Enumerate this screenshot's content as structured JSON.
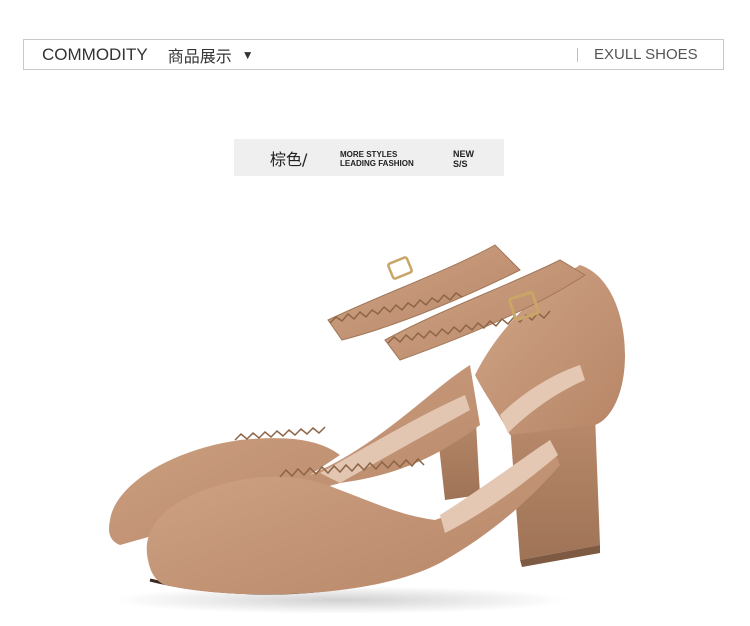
{
  "header": {
    "title_en": "COMMODITY",
    "title_cn": "商品展示",
    "caret": "▼",
    "brand": "EXULL SHOES"
  },
  "banner": {
    "color_name": "棕色/",
    "tagline_line1": "MORE STYLES",
    "tagline_line2": "LEADING FASHION",
    "season_line1": "NEW",
    "season_line2": "S/S"
  },
  "product": {
    "description": "tan suede scalloped-edge block heel ankle strap pumps",
    "color": "#c49a7a"
  }
}
